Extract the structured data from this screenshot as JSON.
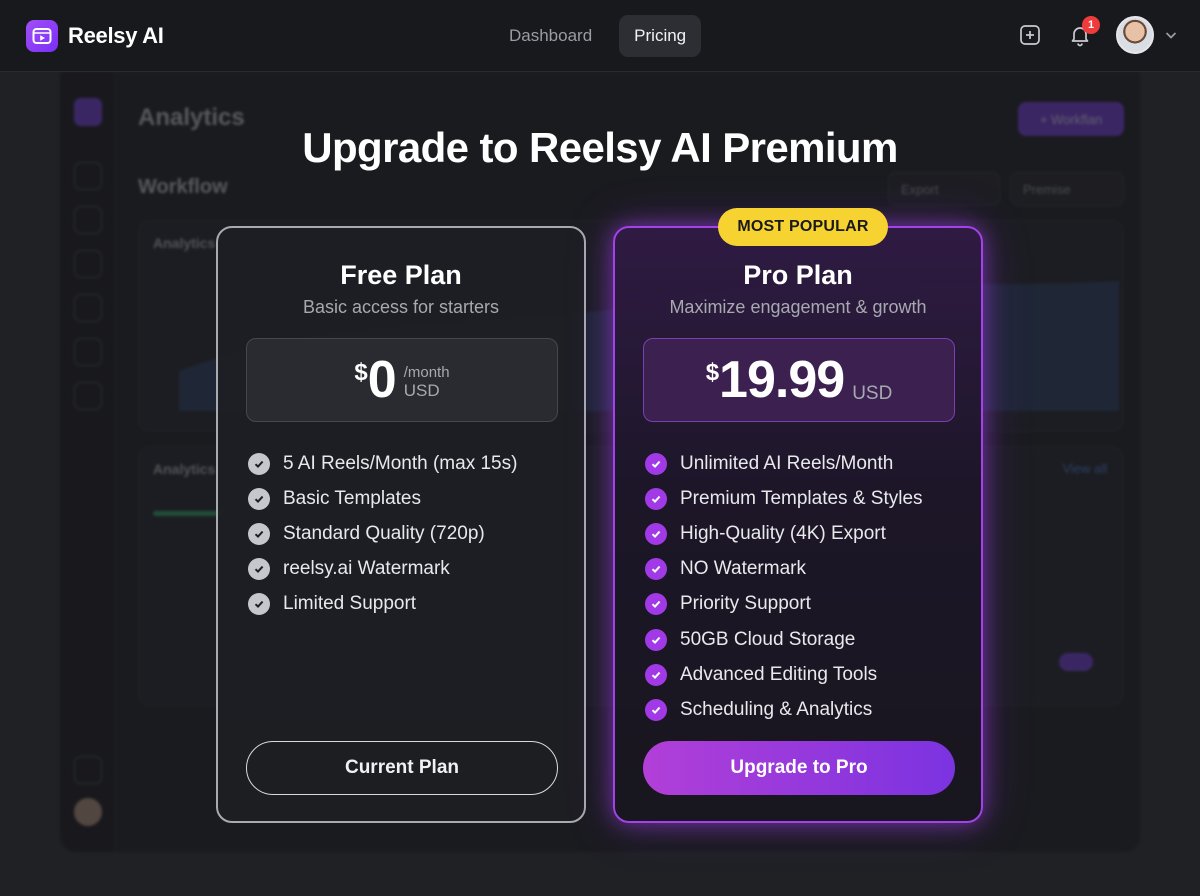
{
  "app": {
    "name": "Reelsy AI"
  },
  "nav": {
    "tabs": [
      {
        "label": "Dashboard"
      },
      {
        "label": "Pricing"
      }
    ]
  },
  "notifications": {
    "count": "1"
  },
  "background": {
    "title": "Analytics",
    "subtitle": "Workflow",
    "primary_button": "+ Workflan",
    "export_label": "Export",
    "filter_label": "Premise",
    "card_label_1": "Analytics",
    "card_label_2": "Analytics",
    "view_all": "View all"
  },
  "headline": "Upgrade to Reelsy AI Premium",
  "plans": {
    "free": {
      "name": "Free Plan",
      "description": "Basic access for starters",
      "currency": "$",
      "amount": "0",
      "period": "/month",
      "unit": "USD",
      "features": [
        "5 AI Reels/Month (max 15s)",
        "Basic Templates",
        "Standard Quality (720p)",
        "reelsy.ai Watermark",
        "Limited Support"
      ],
      "cta": "Current Plan"
    },
    "pro": {
      "badge": "MOST POPULAR",
      "name": "Pro Plan",
      "description": "Maximize engagement & growth",
      "currency": "$",
      "amount": "19.99",
      "unit": "USD",
      "features": [
        "Unlimited AI Reels/Month",
        "Premium Templates & Styles",
        "High-Quality (4K) Export",
        "NO Watermark",
        "Priority Support",
        "50GB Cloud Storage",
        "Advanced Editing Tools",
        "Scheduling & Analytics"
      ],
      "cta": "Upgrade to Pro"
    }
  },
  "colors": {
    "accent": "#a341ea",
    "badge": "#f7d331",
    "notification": "#ef3b3b"
  }
}
